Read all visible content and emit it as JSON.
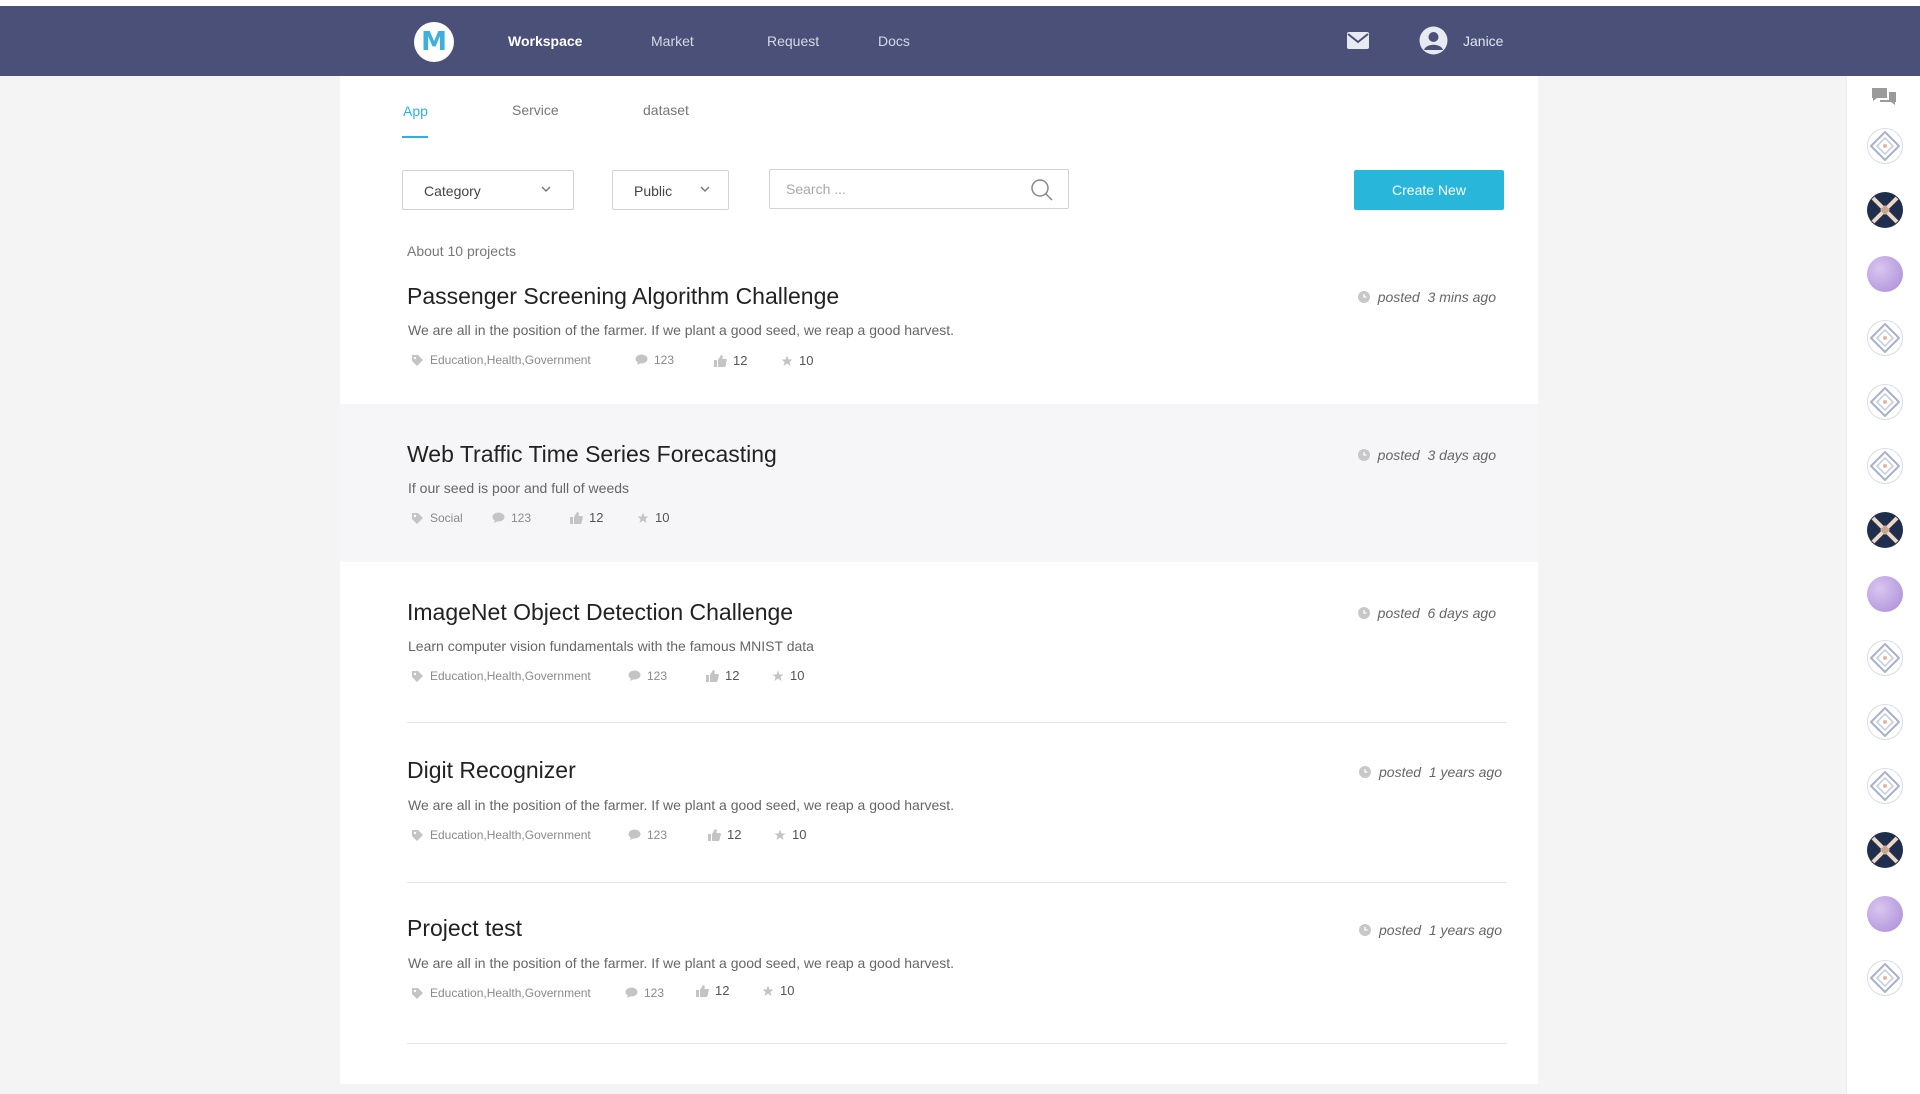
{
  "header": {
    "logo_letter": "M",
    "nav": [
      {
        "label": "Workspace",
        "active": true
      },
      {
        "label": "Market",
        "active": false
      },
      {
        "label": "Request",
        "active": false
      },
      {
        "label": "Docs",
        "active": false
      }
    ],
    "user_name": "Janice",
    "icons": [
      "mail-icon",
      "user-avatar-icon"
    ],
    "color": "#4a5078"
  },
  "tabs": [
    {
      "label": "App",
      "active": true
    },
    {
      "label": "Service",
      "active": false
    },
    {
      "label": "dataset",
      "active": false
    }
  ],
  "filters": {
    "category_label": "Category",
    "visibility_label": "Public",
    "search_placeholder": "Search ...",
    "search_value": "",
    "create_label": "Create New"
  },
  "count_text": "About 10 projects",
  "accent_color": "#29b6db",
  "projects": [
    {
      "title": "Passenger Screening Algorithm Challenge",
      "description": "We are all in the position of the farmer. If we plant a good seed, we reap a good harvest.",
      "tags": "Education,Health,Government",
      "comments": "123",
      "likes": "12",
      "stars": "10",
      "posted_label": "posted",
      "posted_time": "3 mins ago"
    },
    {
      "title": "Web Traffic Time Series Forecasting",
      "description": "If our seed  is poor and full of weeds",
      "tags": "Social",
      "comments": "123",
      "likes": "12",
      "stars": "10",
      "posted_label": "posted",
      "posted_time": "3 days ago"
    },
    {
      "title": "ImageNet Object Detection Challenge",
      "description": "Learn computer vision fundamentals with the famous MNIST data",
      "tags": "Education,Health,Government",
      "comments": "123",
      "likes": "12",
      "stars": "10",
      "posted_label": "posted",
      "posted_time": "6 days ago"
    },
    {
      "title": "Digit Recognizer",
      "description": "We are all in the position of the farmer. If we plant a good seed, we reap a good harvest.",
      "tags": "Education,Health,Government",
      "comments": "123",
      "likes": "12",
      "stars": "10",
      "posted_label": "posted",
      "posted_time": "1 years ago"
    },
    {
      "title": "Project test",
      "description": "We are all in the position of the farmer. If we plant a good seed, we reap a good harvest.",
      "tags": "Education,Health,Government",
      "comments": "123",
      "likes": "12",
      "stars": "10",
      "posted_label": "posted",
      "posted_time": "1 years ago"
    }
  ],
  "sidebar": {
    "icons": [
      "chat-icon"
    ],
    "avatars": [
      "diamond",
      "x",
      "purple",
      "diamond",
      "diamond",
      "diamond",
      "x",
      "purple",
      "diamond",
      "diamond",
      "diamond",
      "x",
      "purple",
      "diamond"
    ]
  }
}
